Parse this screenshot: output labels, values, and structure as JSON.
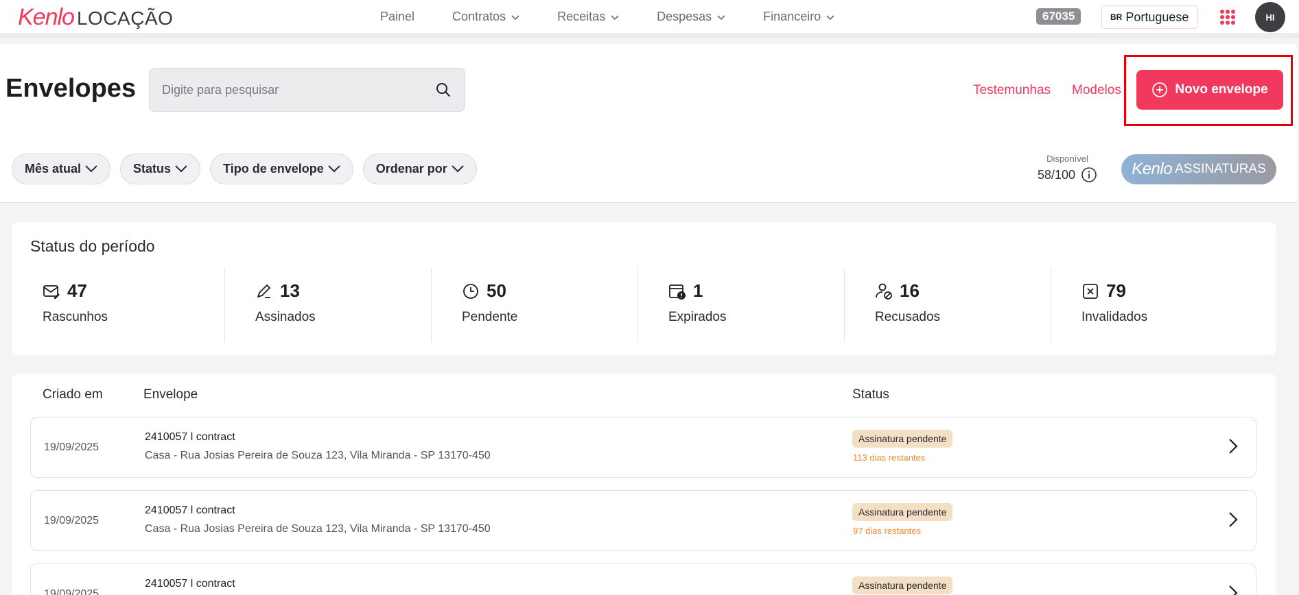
{
  "header": {
    "logo_brand": "Kenlo",
    "logo_sub": "LOCAÇÃO",
    "nav": [
      {
        "label": "Painel",
        "has_menu": false
      },
      {
        "label": "Contratos",
        "has_menu": true
      },
      {
        "label": "Receitas",
        "has_menu": true
      },
      {
        "label": "Despesas",
        "has_menu": true
      },
      {
        "label": "Financeiro",
        "has_menu": true
      }
    ],
    "counter": "67035",
    "language_flag": "BR",
    "language": "Portuguese",
    "avatar_initials": "HI"
  },
  "page": {
    "title": "Envelopes",
    "search_placeholder": "Digite para pesquisar",
    "link_witnesses": "Testemunhas",
    "link_templates": "Modelos",
    "new_button": "Novo envelope",
    "filters": [
      "Mês atual",
      "Status",
      "Tipo de envelope",
      "Ordenar por"
    ],
    "available_label": "Disponível",
    "available_value": "58/100",
    "brand_badge_1": "Kenlo",
    "brand_badge_2": "ASSINATURAS"
  },
  "status_card": {
    "title": "Status do período",
    "stats": [
      {
        "count": "47",
        "label": "Rascunhos",
        "icon": "draft-envelope-icon"
      },
      {
        "count": "13",
        "label": "Assinados",
        "icon": "pen-icon"
      },
      {
        "count": "50",
        "label": "Pendente",
        "icon": "clock-icon"
      },
      {
        "count": "1",
        "label": "Expirados",
        "icon": "calendar-alert-icon"
      },
      {
        "count": "16",
        "label": "Recusados",
        "icon": "user-blocked-icon"
      },
      {
        "count": "79",
        "label": "Invalidados",
        "icon": "x-square-icon"
      }
    ]
  },
  "table": {
    "headers": {
      "created": "Criado em",
      "envelope": "Envelope",
      "status": "Status"
    },
    "rows": [
      {
        "date": "19/09/2025",
        "code": "2410057 l contract",
        "address": "Casa - Rua Josias Pereira de Souza 123, Vila Miranda - SP 13170-450",
        "status": "Assinatura pendente",
        "days": "113 dias restantes"
      },
      {
        "date": "19/09/2025",
        "code": "2410057 l contract",
        "address": "Casa - Rua Josias Pereira de Souza 123, Vila Miranda - SP 13170-450",
        "status": "Assinatura pendente",
        "days": "97 dias restantes"
      },
      {
        "date": "19/09/2025",
        "code": "2410057 l contract",
        "address": "",
        "status": "Assinatura pendente",
        "days": ""
      }
    ]
  },
  "colors": {
    "accent": "#f2385d",
    "badge_bg": "#f3dfc4",
    "days_text": "#ef8c2e"
  }
}
